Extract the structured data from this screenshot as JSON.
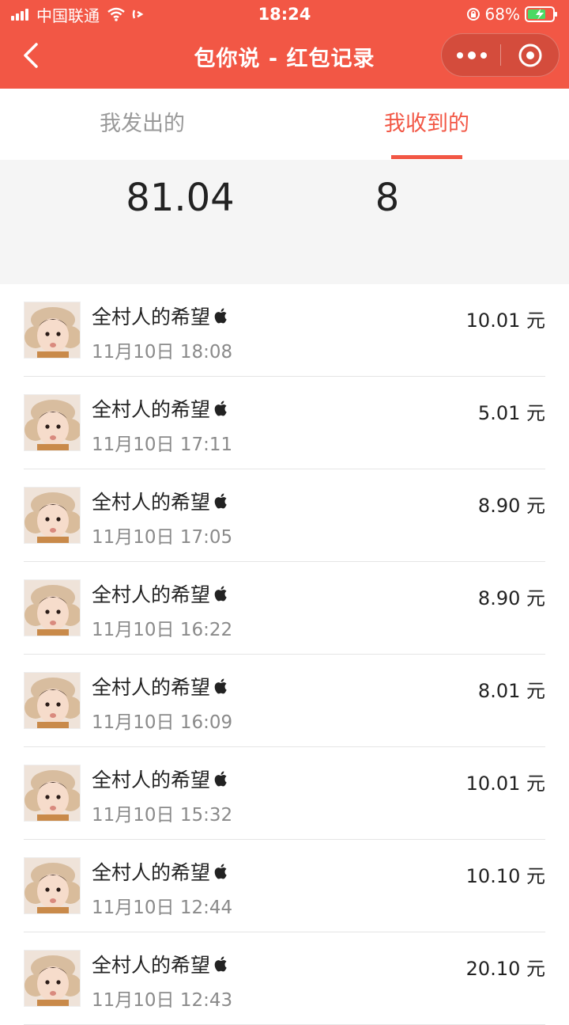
{
  "status_bar": {
    "carrier": "中国联通",
    "time": "18:24",
    "battery": "68%"
  },
  "nav": {
    "title": "包你说 - 红包记录"
  },
  "tabs": {
    "sent": "我发出的",
    "received": "我收到的"
  },
  "summary": {
    "total": "81.04",
    "count": "8"
  },
  "records": [
    {
      "name": "全村人的希望",
      "time": "11月10日 18:08",
      "amount": "10.01 元"
    },
    {
      "name": "全村人的希望",
      "time": "11月10日 17:11",
      "amount": "5.01 元"
    },
    {
      "name": "全村人的希望",
      "time": "11月10日 17:05",
      "amount": "8.90 元"
    },
    {
      "name": "全村人的希望",
      "time": "11月10日 16:22",
      "amount": "8.90 元"
    },
    {
      "name": "全村人的希望",
      "time": "11月10日 16:09",
      "amount": "8.01 元"
    },
    {
      "name": "全村人的希望",
      "time": "11月10日 15:32",
      "amount": "10.01 元"
    },
    {
      "name": "全村人的希望",
      "time": "11月10日 12:44",
      "amount": "10.10 元"
    },
    {
      "name": "全村人的希望",
      "time": "11月10日 12:43",
      "amount": "20.10 元"
    }
  ],
  "colors": {
    "brand": "#F25745",
    "summary_bg": "#F5F5F5"
  }
}
